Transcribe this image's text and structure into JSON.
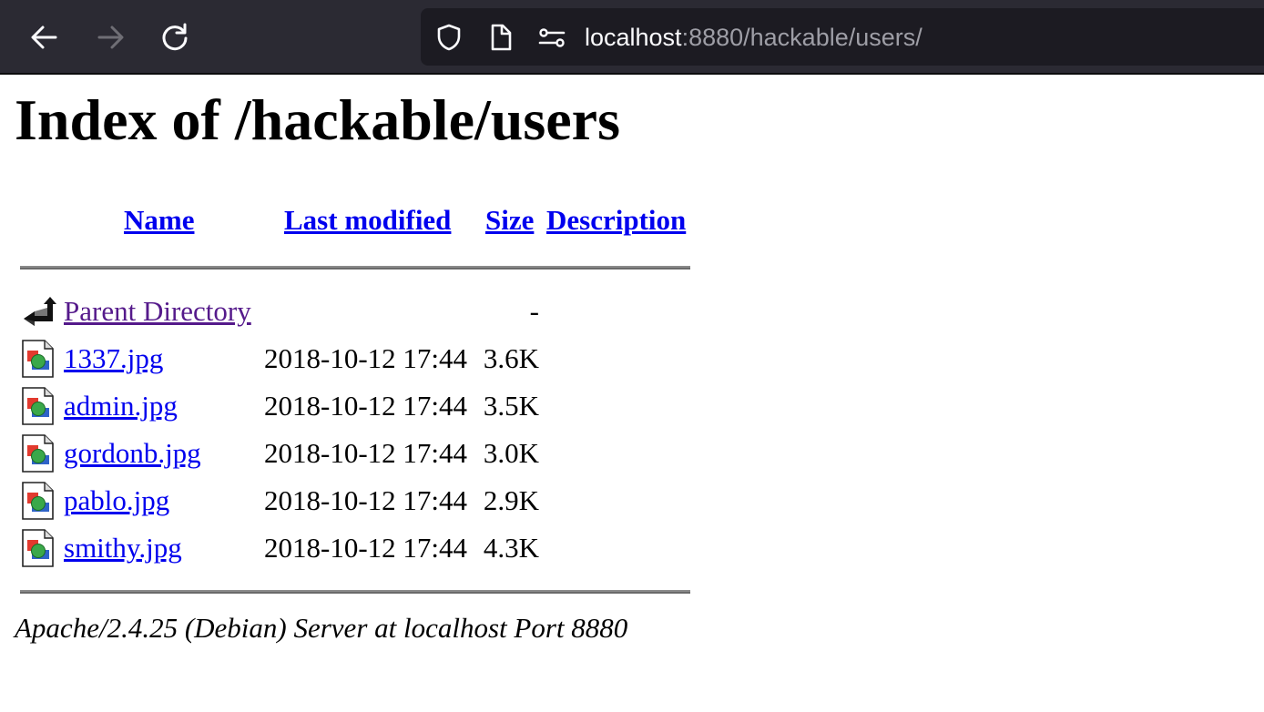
{
  "browser": {
    "url_host": "localhost",
    "url_rest": ":8880/hackable/users/",
    "icons": {
      "back": "arrow-left-icon",
      "forward": "arrow-right-icon",
      "reload": "reload-icon",
      "shield": "shield-icon",
      "page": "page-icon",
      "permissions": "permissions-icon"
    }
  },
  "page": {
    "title": "Index of /hackable/users",
    "columns": {
      "name": "Name",
      "last_modified": "Last modified",
      "size": "Size",
      "description": "Description"
    },
    "parent": {
      "label": "Parent Directory",
      "size": "-"
    },
    "rows": [
      {
        "name": "1337.jpg",
        "modified": "2018-10-12 17:44",
        "size": "3.6K"
      },
      {
        "name": "admin.jpg",
        "modified": "2018-10-12 17:44",
        "size": "3.5K"
      },
      {
        "name": "gordonb.jpg",
        "modified": "2018-10-12 17:44",
        "size": "3.0K"
      },
      {
        "name": "pablo.jpg",
        "modified": "2018-10-12 17:44",
        "size": "2.9K"
      },
      {
        "name": "smithy.jpg",
        "modified": "2018-10-12 17:44",
        "size": "4.3K"
      }
    ],
    "footer": "Apache/2.4.25 (Debian) Server at localhost Port 8880"
  },
  "colors": {
    "toolbar_bg": "#2b2a33",
    "urlbar_bg": "#1c1b22",
    "link": "#0000ee",
    "visited_link": "#551a8b"
  }
}
